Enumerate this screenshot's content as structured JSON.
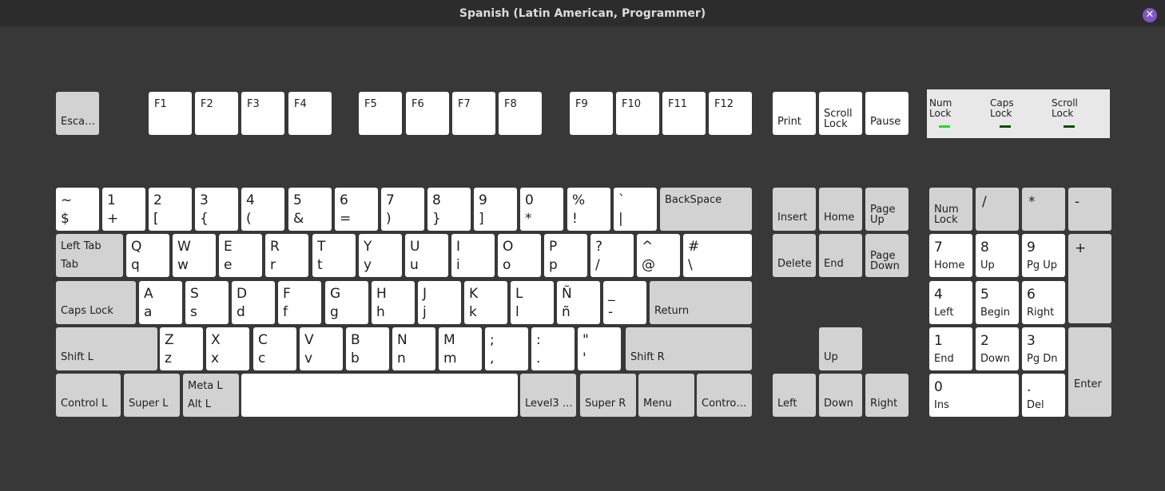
{
  "window": {
    "title": "Spanish (Latin American, Programmer)",
    "close_glyph": "✕"
  },
  "keys": {
    "esc": "Esca…",
    "f1": "F1",
    "f2": "F2",
    "f3": "F3",
    "f4": "F4",
    "f5": "F5",
    "f6": "F6",
    "f7": "F7",
    "f8": "F8",
    "f9": "F9",
    "f10": "F10",
    "f11": "F11",
    "f12": "F12",
    "print": "Print",
    "scroll_lock": "Scroll\nLock",
    "pause": "Pause",
    "grave": {
      "top": "~",
      "bottom": "$"
    },
    "n1": {
      "top": "1",
      "bottom": "+"
    },
    "n2": {
      "top": "2",
      "bottom": "["
    },
    "n3": {
      "top": "3",
      "bottom": "{"
    },
    "n4": {
      "top": "4",
      "bottom": "("
    },
    "n5": {
      "top": "5",
      "bottom": "&"
    },
    "n6": {
      "top": "6",
      "bottom": "="
    },
    "n7": {
      "top": "7",
      "bottom": ")"
    },
    "n8": {
      "top": "8",
      "bottom": "}"
    },
    "n9": {
      "top": "9",
      "bottom": "]"
    },
    "n0": {
      "top": "0",
      "bottom": "*"
    },
    "minus": {
      "top": "%",
      "bottom": "!"
    },
    "equal": {
      "top": "`",
      "bottom": "|"
    },
    "backspace": "BackSpace",
    "tab": {
      "top": "Left Tab",
      "bottom": "Tab"
    },
    "q": {
      "top": "Q",
      "bottom": "q"
    },
    "w": {
      "top": "W",
      "bottom": "w"
    },
    "e": {
      "top": "E",
      "bottom": "e"
    },
    "r": {
      "top": "R",
      "bottom": "r"
    },
    "t": {
      "top": "T",
      "bottom": "t"
    },
    "y": {
      "top": "Y",
      "bottom": "y"
    },
    "u": {
      "top": "U",
      "bottom": "u"
    },
    "i": {
      "top": "I",
      "bottom": "i"
    },
    "o": {
      "top": "O",
      "bottom": "o"
    },
    "p": {
      "top": "P",
      "bottom": "p"
    },
    "lbracket": {
      "top": "?",
      "bottom": "/"
    },
    "rbracket": {
      "top": "^",
      "bottom": "@"
    },
    "backslash": {
      "top": "#",
      "bottom": "\\"
    },
    "caps": "Caps Lock",
    "a": {
      "top": "A",
      "bottom": "a"
    },
    "s": {
      "top": "S",
      "bottom": "s"
    },
    "d": {
      "top": "D",
      "bottom": "d"
    },
    "f": {
      "top": "F",
      "bottom": "f"
    },
    "g": {
      "top": "G",
      "bottom": "g"
    },
    "h": {
      "top": "H",
      "bottom": "h"
    },
    "j": {
      "top": "J",
      "bottom": "j"
    },
    "k": {
      "top": "K",
      "bottom": "k"
    },
    "l": {
      "top": "L",
      "bottom": "l"
    },
    "semicolon": {
      "top": "Ñ",
      "bottom": "ñ"
    },
    "quote": {
      "top": "_",
      "bottom": "-"
    },
    "return": "Return",
    "shift_l": "Shift L",
    "z": {
      "top": "Z",
      "bottom": "z"
    },
    "x": {
      "top": "X",
      "bottom": "x"
    },
    "c": {
      "top": "C",
      "bottom": "c"
    },
    "v": {
      "top": "V",
      "bottom": "v"
    },
    "b": {
      "top": "B",
      "bottom": "b"
    },
    "n": {
      "top": "N",
      "bottom": "n"
    },
    "m": {
      "top": "M",
      "bottom": "m"
    },
    "comma": {
      "top": ";",
      "bottom": ","
    },
    "period": {
      "top": ":",
      "bottom": "."
    },
    "slash": {
      "top": "\"",
      "bottom": "'"
    },
    "shift_r": "Shift R",
    "control_l": "Control L",
    "super_l": "Super L",
    "alt_l": {
      "top": "Meta L",
      "bottom": "Alt L"
    },
    "level3": "Level3 …",
    "super_r": "Super R",
    "menu": "Menu",
    "control_r": "Contro…",
    "insert": "Insert",
    "home": "Home",
    "page_up": "Page\nUp",
    "delete": "Delete",
    "end": "End",
    "page_down": "Page\nDown",
    "up": "Up",
    "left": "Left",
    "down": "Down",
    "right": "Right",
    "num_lock": "Num\nLock",
    "kp_divide": "/",
    "kp_multiply": "*",
    "kp_minus": "-",
    "kp_plus": "+",
    "kp7": {
      "top": "7",
      "bottom": "Home"
    },
    "kp8": {
      "top": "8",
      "bottom": "Up"
    },
    "kp9": {
      "top": "9",
      "bottom": "Pg Up"
    },
    "kp4": {
      "top": "4",
      "bottom": "Left"
    },
    "kp5": {
      "top": "5",
      "bottom": "Begin"
    },
    "kp6": {
      "top": "6",
      "bottom": "Right"
    },
    "kp1": {
      "top": "1",
      "bottom": "End"
    },
    "kp2": {
      "top": "2",
      "bottom": "Down"
    },
    "kp3": {
      "top": "3",
      "bottom": "Pg Dn"
    },
    "kp0": {
      "top": "0",
      "bottom": "Ins"
    },
    "kp_decimal": {
      "top": ".",
      "bottom": "Del"
    },
    "kp_enter": "Enter"
  },
  "leds": {
    "num_lock": {
      "label": "Num\nLock",
      "color": "#22dd22"
    },
    "caps_lock": {
      "label": "Caps\nLock",
      "color": "#0a4a0a"
    },
    "scroll_lock": {
      "label": "Scroll\nLock",
      "color": "#0a4a0a"
    }
  }
}
